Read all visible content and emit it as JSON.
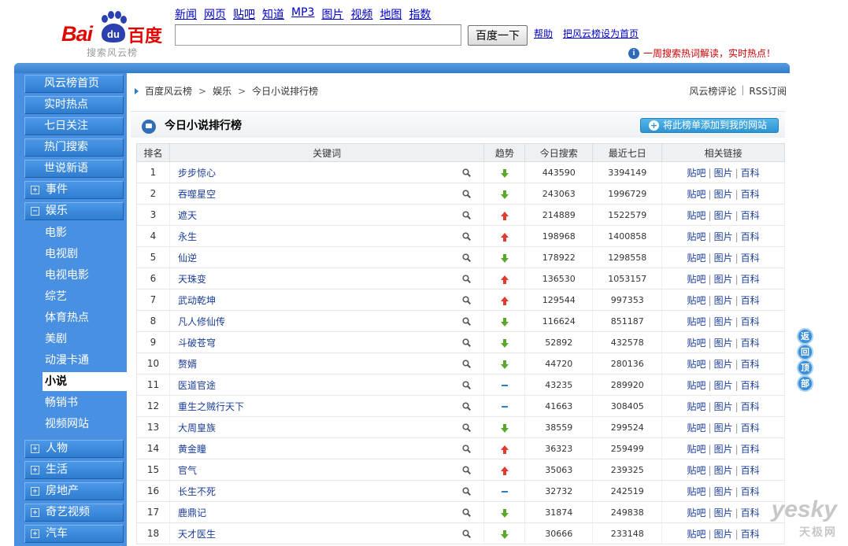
{
  "logo": {
    "latin": "Bai",
    "du": "du",
    "chinese": "百度",
    "subtitle": "搜索风云榜"
  },
  "topnav": [
    "新闻",
    "网页",
    "贴吧",
    "知道",
    "MP3",
    "图片",
    "视频",
    "地图",
    "指数"
  ],
  "search": {
    "value": "",
    "button_label": "百度一下"
  },
  "header_links": {
    "help": "帮助",
    "set_home": "把风云榜设为首页"
  },
  "hot_tip": "一周搜索热词解读，实时热点！",
  "sidebar": {
    "top_items": [
      "风云榜首页",
      "实时热点",
      "七日关注",
      "热门搜索",
      "世说新语"
    ],
    "expand_items": [
      {
        "label": "事件",
        "state": "+"
      },
      {
        "label": "娱乐",
        "state": "−"
      }
    ],
    "sub_items": [
      "电影",
      "电视剧",
      "电视电影",
      "综艺",
      "体育热点",
      "美剧",
      "动漫卡通",
      "小说",
      "畅销书",
      "视频网站"
    ],
    "active_sub": "小说",
    "bottom_items": [
      {
        "label": "人物",
        "state": "+"
      },
      {
        "label": "生活",
        "state": "+"
      },
      {
        "label": "房地产",
        "state": "+"
      },
      {
        "label": "奇艺视频",
        "state": "+"
      },
      {
        "label": "汽车",
        "state": "+"
      }
    ]
  },
  "breadcrumb": [
    "百度风云榜",
    "娱乐",
    "今日小说排行榜"
  ],
  "breadcrumb_sep": ">",
  "top_right_links": {
    "review": "风云榜评论",
    "divider": "|",
    "rss": "RSS订阅"
  },
  "list_title": "今日小说排行榜",
  "add_button": "将此榜单添加到我的网站",
  "table": {
    "headers": [
      "排名",
      "关键词",
      "趋势",
      "今日搜索",
      "最近七日",
      "相关链接"
    ],
    "link_labels": [
      "贴吧",
      "图片",
      "百科"
    ],
    "link_sep": "|",
    "rows": [
      {
        "rank": "1",
        "keyword": "步步惊心",
        "trend": "down",
        "today": "443590",
        "week": "3394149"
      },
      {
        "rank": "2",
        "keyword": "吞噬星空",
        "trend": "down",
        "today": "243063",
        "week": "1996729"
      },
      {
        "rank": "3",
        "keyword": "遮天",
        "trend": "up",
        "today": "214889",
        "week": "1522579"
      },
      {
        "rank": "4",
        "keyword": "永生",
        "trend": "up",
        "today": "198968",
        "week": "1400858"
      },
      {
        "rank": "5",
        "keyword": "仙逆",
        "trend": "down",
        "today": "178922",
        "week": "1298558"
      },
      {
        "rank": "6",
        "keyword": "天珠变",
        "trend": "up",
        "today": "136530",
        "week": "1053157"
      },
      {
        "rank": "7",
        "keyword": "武动乾坤",
        "trend": "up",
        "today": "129544",
        "week": "997353"
      },
      {
        "rank": "8",
        "keyword": "凡人修仙传",
        "trend": "down",
        "today": "116624",
        "week": "851187"
      },
      {
        "rank": "9",
        "keyword": "斗破苍穹",
        "trend": "down",
        "today": "52892",
        "week": "432578"
      },
      {
        "rank": "10",
        "keyword": "赘婿",
        "trend": "down",
        "today": "44720",
        "week": "280136"
      },
      {
        "rank": "11",
        "keyword": "医道官途",
        "trend": "flat",
        "today": "43235",
        "week": "289920"
      },
      {
        "rank": "12",
        "keyword": "重生之贼行天下",
        "trend": "flat",
        "today": "41663",
        "week": "308405"
      },
      {
        "rank": "13",
        "keyword": "大周皇族",
        "trend": "down",
        "today": "38559",
        "week": "299524"
      },
      {
        "rank": "14",
        "keyword": "黄金瞳",
        "trend": "up",
        "today": "36323",
        "week": "259499"
      },
      {
        "rank": "15",
        "keyword": "官气",
        "trend": "up",
        "today": "35063",
        "week": "239325"
      },
      {
        "rank": "16",
        "keyword": "长生不死",
        "trend": "flat",
        "today": "32732",
        "week": "242519"
      },
      {
        "rank": "17",
        "keyword": "鹿鼎记",
        "trend": "down",
        "today": "31874",
        "week": "249838"
      },
      {
        "rank": "18",
        "keyword": "天才医生",
        "trend": "down",
        "today": "30666",
        "week": "233148"
      }
    ]
  },
  "back_to_top": [
    "返",
    "回",
    "顶",
    "部"
  ],
  "watermark": {
    "main": "yesky",
    "sub": "天极网"
  },
  "colors": {
    "frame_blue": "#2d7ccc",
    "link_blue": "#1a3d99",
    "trend_up": "#e23b2e",
    "trend_down": "#5aa82b",
    "baidu_red": "#e10601"
  }
}
